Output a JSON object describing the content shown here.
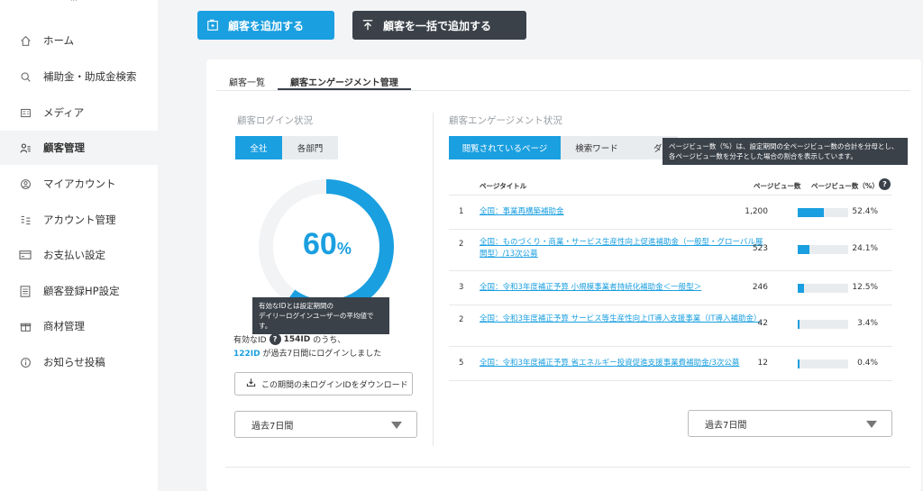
{
  "sidebar": {
    "brand": "...",
    "items": [
      {
        "label": "ホーム",
        "icon": "home-icon"
      },
      {
        "label": "補助金・助成金検索",
        "icon": "search-icon"
      },
      {
        "label": "メディア",
        "icon": "media-icon"
      },
      {
        "label": "顧客管理",
        "icon": "customer-icon",
        "active": true
      },
      {
        "label": "マイアカウント",
        "icon": "account-icon"
      },
      {
        "label": "アカウント管理",
        "icon": "account-manage-icon"
      },
      {
        "label": "お支払い設定",
        "icon": "payment-icon"
      },
      {
        "label": "顧客登録HP設定",
        "icon": "document-icon"
      },
      {
        "label": "商材管理",
        "icon": "gift-icon"
      },
      {
        "label": "お知らせ投稿",
        "icon": "info-icon"
      }
    ]
  },
  "actions": {
    "add_customer": "顧客を追加する",
    "bulk_add": "顧客を一括で追加する"
  },
  "tabs": [
    "顧客一覧",
    "顧客エンゲージメント管理"
  ],
  "login": {
    "title": "顧客ログイン状況",
    "segments": [
      "全社",
      "各部門"
    ],
    "percent": 60,
    "percent_text": "60",
    "percent_unit": "%",
    "tooltip_line1": "有効なIDとは設定期間の",
    "tooltip_line2": "デイリーログインユーザーの平均値です。",
    "valid_id_prefix": "有効なID",
    "valid_id_count": "154ID",
    "valid_id_suffix": "のうち、",
    "logged_in_count": "122ID",
    "logged_in_suffix": "が過去7日間にログインしました",
    "download_label": "この期間の未ログインIDをダウンロード",
    "period": "過去7日間"
  },
  "engagement": {
    "title": "顧客エンゲージメント状況",
    "tabs": [
      "閲覧されているページ",
      "検索ワード",
      "ダウ"
    ],
    "tooltip_line1": "ページビュー数（%）は、設定期間の全ページビュー数の合計を分母とし、",
    "tooltip_line2": "各ページビュー数を分子とした場合の割合を表示しています。",
    "col_title": "ページタイトル",
    "col_views": "ページビュー数",
    "col_pct": "ページビュー数（%）",
    "rows": [
      {
        "num": "1",
        "title": "全国：事業再構築補助金",
        "views": "1,200",
        "pct": "52.4%",
        "ratio": 0.524
      },
      {
        "num": "2",
        "title": "全国：ものづくり・商業・サービス生産性向上促進補助金（一般型・グローバル展開型）/13次公募",
        "views": "523",
        "pct": "24.1%",
        "ratio": 0.241
      },
      {
        "num": "3",
        "title": "全国：令和3年度補正予算 小規模事業者持続化補助金＜一般型＞",
        "views": "246",
        "pct": "12.5%",
        "ratio": 0.125
      },
      {
        "num": "2",
        "title": "全国：令和3年度補正予算 サービス等生産性向上IT導入支援事業（IT導入補助金）",
        "views": "42",
        "pct": "3.4%",
        "ratio": 0.034
      },
      {
        "num": "5",
        "title": "全国：令和3年度補正予算 省エネルギー投資促進支援事業費補助金/3次公募",
        "views": "12",
        "pct": "0.4%",
        "ratio": 0.004
      }
    ],
    "period": "過去7日間"
  },
  "colors": {
    "accent": "#1a9fe0",
    "dark": "#3a4149"
  }
}
